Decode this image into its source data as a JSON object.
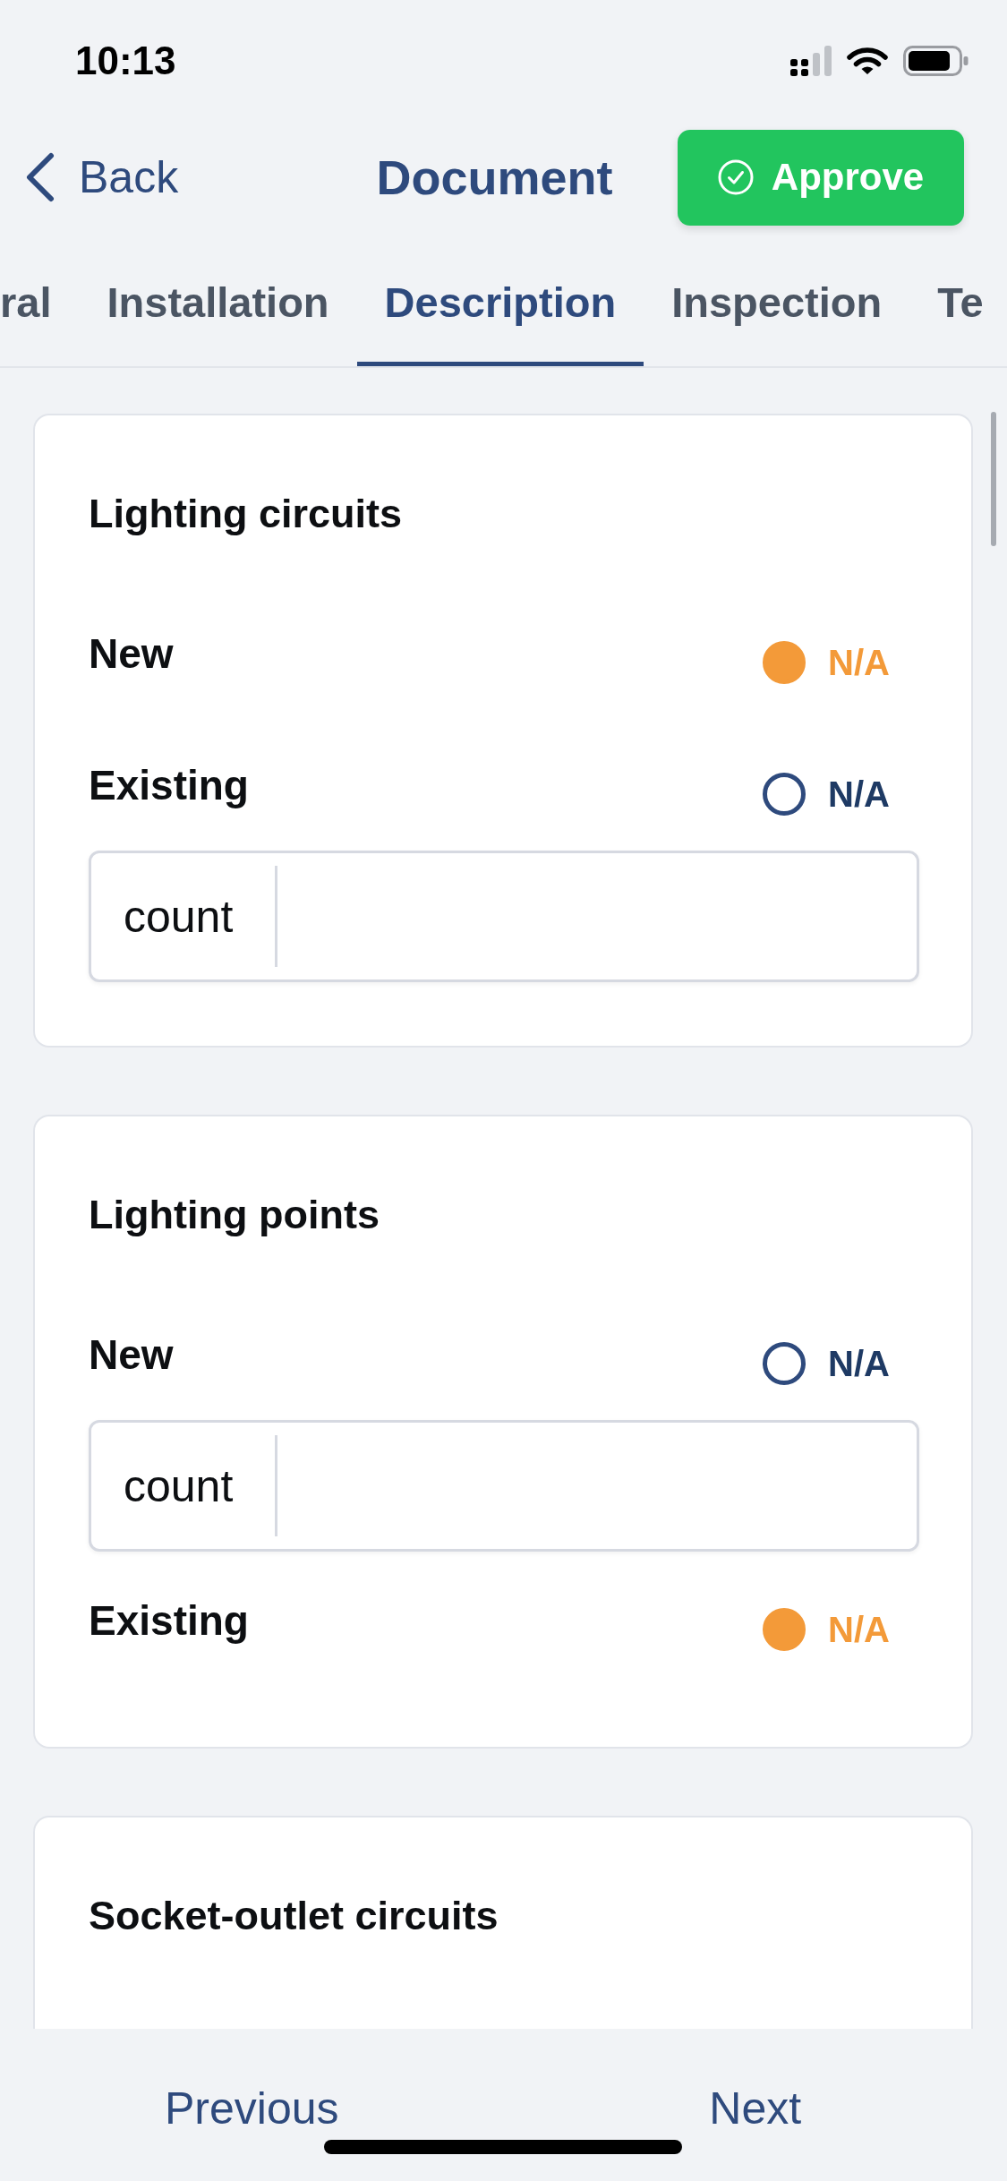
{
  "status_bar": {
    "time": "10:13"
  },
  "header": {
    "back": "Back",
    "title": "Document",
    "approve": "Approve"
  },
  "tabs": [
    {
      "label": "ral",
      "selected": false
    },
    {
      "label": "Installation",
      "selected": false
    },
    {
      "label": "Description",
      "selected": true
    },
    {
      "label": "Inspection",
      "selected": false
    },
    {
      "label": "Te",
      "selected": false
    }
  ],
  "sections": [
    {
      "title": "Lighting circuits",
      "rows": [
        {
          "label": "New",
          "na": {
            "label": "N/A",
            "checked": true
          }
        },
        {
          "label": "Existing",
          "na": {
            "label": "N/A",
            "checked": false
          },
          "field": {
            "prefix": "count"
          }
        }
      ]
    },
    {
      "title": "Lighting points",
      "rows": [
        {
          "label": "New",
          "na": {
            "label": "N/A",
            "checked": false
          },
          "field": {
            "prefix": "count"
          }
        },
        {
          "label": "Existing",
          "na": {
            "label": "N/A",
            "checked": true
          }
        }
      ]
    },
    {
      "title": "Socket-outlet circuits"
    }
  ],
  "footer": {
    "previous": "Previous",
    "next": "Next"
  }
}
